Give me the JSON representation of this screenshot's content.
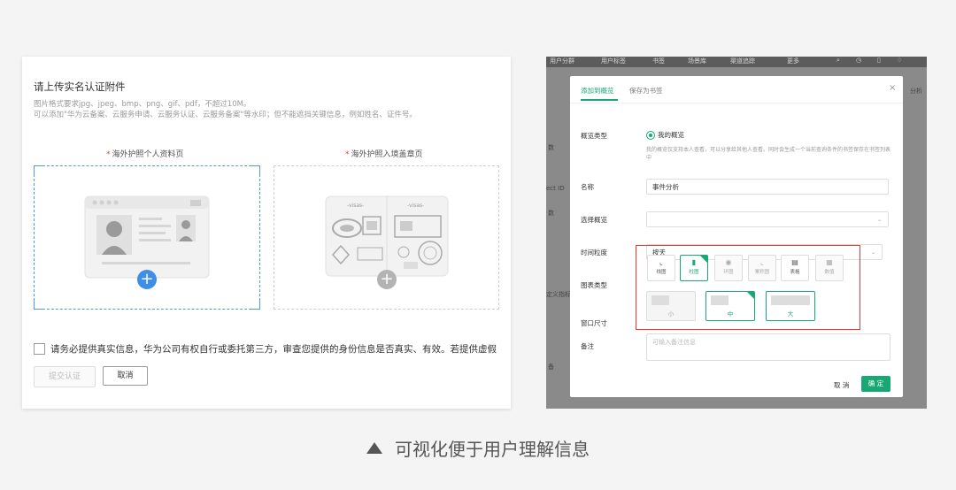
{
  "left_panel": {
    "title": "请上传实名认证附件",
    "hint_line1": "图片格式要求jpg、jpeg、bmp、png、gif、pdf，不超过10M。",
    "hint_line2": "可以添加\"华为云备案、云服务申请、云服务认证、云服务备案\"等水印；但不能遮挡关键信息，例如姓名、证件号。",
    "upload1_label": "海外护照个人资料页",
    "upload2_label": "海外护照入境盖章页",
    "required_mark": "*",
    "visa_stamp_text": "-visas-",
    "plus": "+",
    "agree_text": "请务必提供真实信息，华为公司有权自行或委托第三方，审查您提供的身份信息是否真实、有效。若提供虚假",
    "submit_label": "提交认证",
    "cancel_label": "取消",
    "colors": {
      "accent": "#4a9be8",
      "required": "#e84040"
    }
  },
  "right_panel": {
    "topnav": [
      "用户分群",
      "用户标签",
      "书签",
      "场景库",
      "渠道追踪",
      "更多"
    ],
    "bg_left_labels": [
      "数",
      "ect ID",
      "数",
      "定义指标",
      "备"
    ],
    "bg_right_text": "分析",
    "modal": {
      "tab_active": "添加到概览",
      "tab_other": "保存为书签",
      "close": "×",
      "overview_type_label": "概览类型",
      "overview_type_value": "我的概览",
      "overview_hint": "我的概览仅支持本人查看，可以分享给其他人查看。同时会生成一个当前查询条件的书签保存在书签列表中",
      "name_label": "名称",
      "name_value": "事件分析",
      "select_label": "选择概览",
      "select_value": "",
      "granularity_label": "时间粒度",
      "granularity_value": "按天",
      "chart_type_label": "图表类型",
      "chart_types": [
        {
          "label": "线图",
          "icon": "line-chart-icon",
          "glyph": "⌞",
          "state": "enabled"
        },
        {
          "label": "柱图",
          "icon": "bar-chart-icon",
          "glyph": "▮",
          "state": "selected"
        },
        {
          "label": "环图",
          "icon": "donut-chart-icon",
          "glyph": "◉",
          "state": "disabled"
        },
        {
          "label": "累积图",
          "icon": "area-chart-icon",
          "glyph": "⌞",
          "state": "disabled"
        },
        {
          "label": "表格",
          "icon": "table-icon",
          "glyph": "▤",
          "state": "enabled"
        },
        {
          "label": "数值",
          "icon": "number-icon",
          "glyph": "▦",
          "state": "disabled"
        }
      ],
      "size_label": "窗口尺寸",
      "sizes": [
        {
          "label": "小",
          "state": "disabled"
        },
        {
          "label": "中",
          "state": "selected"
        },
        {
          "label": "大",
          "state": "enabled"
        }
      ],
      "remark_label": "备注",
      "remark_placeholder": "可输入备注信息",
      "cancel_label": "取 消",
      "ok_label": "确 定",
      "colors": {
        "accent": "#18a874",
        "highlight": "#e53935"
      }
    }
  },
  "caption": "可视化便于用户理解信息"
}
